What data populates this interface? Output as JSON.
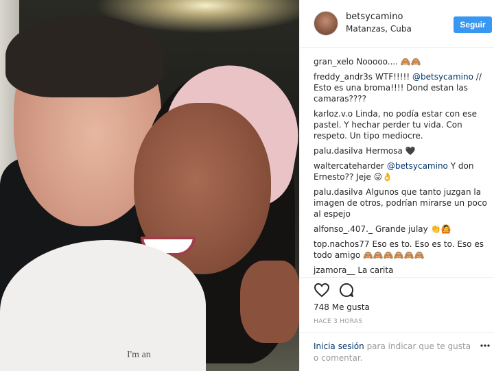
{
  "post": {
    "username": "betsycamino",
    "location": "Matanzas, Cuba",
    "follow_label": "Seguir",
    "shirt_text": "I'm an"
  },
  "comments": [
    {
      "user": "gran_xelo",
      "text": "Nooooo....",
      "emoji": "🙈🙈"
    },
    {
      "user": "freddy_andr3s",
      "text_before": "WTF!!!!! ",
      "mention": "@betsycamino",
      "text_after": " // Esto es una broma!!!! Dond estan las camaras????",
      "emoji": ""
    },
    {
      "user": "karloz.v.o",
      "text": "Linda, no podía estar con ese pastel. Y hechar perder tu vida. Con respeto. Un tipo mediocre.",
      "emoji": ""
    },
    {
      "user": "palu.dasilva",
      "text": "Hermosa",
      "emoji": "🖤"
    },
    {
      "user": "waltercateharder",
      "text_before": "",
      "mention": "@betsycamino",
      "text_after": " Y don Ernesto?? Jeje",
      "emoji": "😜👌"
    },
    {
      "user": "palu.dasilva",
      "text": "Algunos que tanto juzgan la imagen de otros, podrían mirarse un poco al espejo",
      "emoji": ""
    },
    {
      "user": "alfonso_.407._",
      "text": "Grande julay",
      "emoji": "👏🙆"
    },
    {
      "user": "top.nachos77",
      "text": "Eso es to. Eso es to. Eso es todo amigo",
      "emoji": "🙈🙈🙈🙈🙈🙈"
    },
    {
      "user": "jzamora__",
      "text": "La carita",
      "emoji": ""
    }
  ],
  "actions": {
    "like_icon": "heart-icon",
    "comment_icon": "comment-bubble-icon"
  },
  "likes": "748 Me gusta",
  "time": "HACE 3 HORAS",
  "footer": {
    "login": "Inicia sesión",
    "rest": " para indicar que te gusta o comentar.",
    "more_icon": "ellipsis-icon"
  }
}
